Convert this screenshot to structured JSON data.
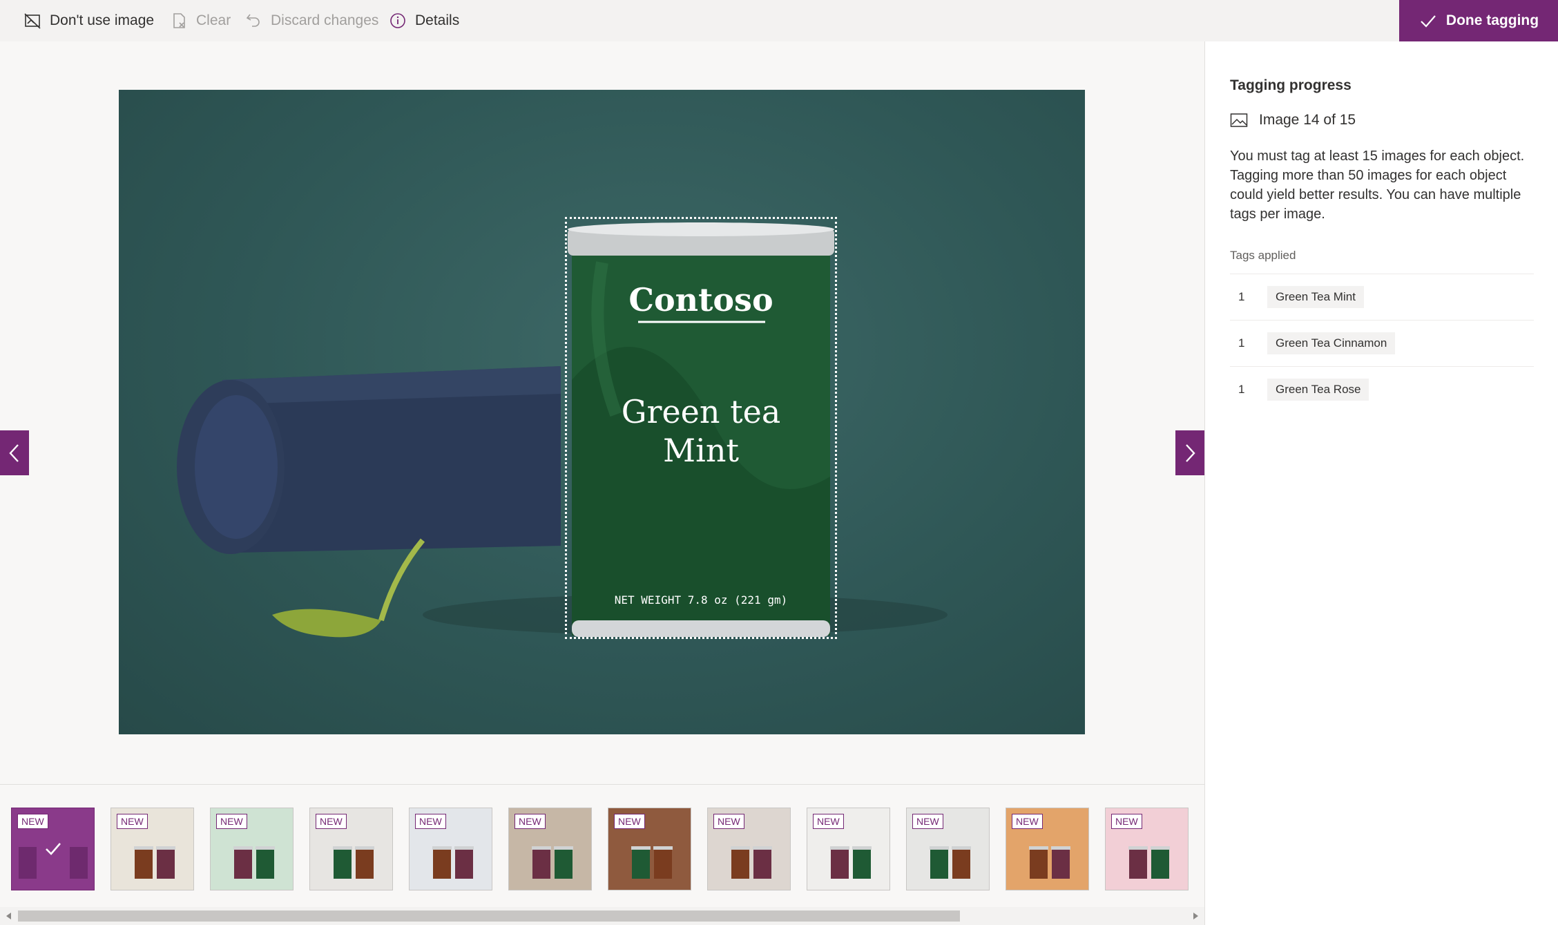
{
  "toolbar": {
    "dont_use_image": "Don't use image",
    "clear": "Clear",
    "discard_changes": "Discard changes",
    "details": "Details",
    "done_tagging": "Done tagging"
  },
  "colors": {
    "accent": "#742774",
    "image_background": "#2f5756",
    "can_green": "#1f5a34"
  },
  "main_image": {
    "brand": "Contoso",
    "product_line1": "Green tea",
    "product_line2": "Mint",
    "net_weight": "NET WEIGHT 7.8 oz (221 gm)"
  },
  "right_panel": {
    "title": "Tagging progress",
    "progress_text": "Image 14 of 15",
    "description": "You must tag at least 15 images for each object. Tagging more than 50 images for each object could yield better results. You can have multiple tags per image.",
    "tags_label": "Tags applied",
    "tags": [
      {
        "count": "1",
        "name": "Green Tea Mint"
      },
      {
        "count": "1",
        "name": "Green Tea Cinnamon"
      },
      {
        "count": "1",
        "name": "Green Tea Rose"
      }
    ]
  },
  "thumbnails": {
    "badge": "NEW",
    "items": [
      {
        "bg": "#8a3a8a",
        "selected": true
      },
      {
        "bg": "#e9e4da",
        "selected": false
      },
      {
        "bg": "#cfe3d3",
        "selected": false
      },
      {
        "bg": "#e7e5e2",
        "selected": false
      },
      {
        "bg": "#e3e6ea",
        "selected": false
      },
      {
        "bg": "#c6b7a6",
        "selected": false
      },
      {
        "bg": "#8f5a3e",
        "selected": false
      },
      {
        "bg": "#ddd6d0",
        "selected": false
      },
      {
        "bg": "#efeeec",
        "selected": false
      },
      {
        "bg": "#e6e6e4",
        "selected": false
      },
      {
        "bg": "#e3a46a",
        "selected": false
      },
      {
        "bg": "#f2cfd6",
        "selected": false
      }
    ]
  }
}
